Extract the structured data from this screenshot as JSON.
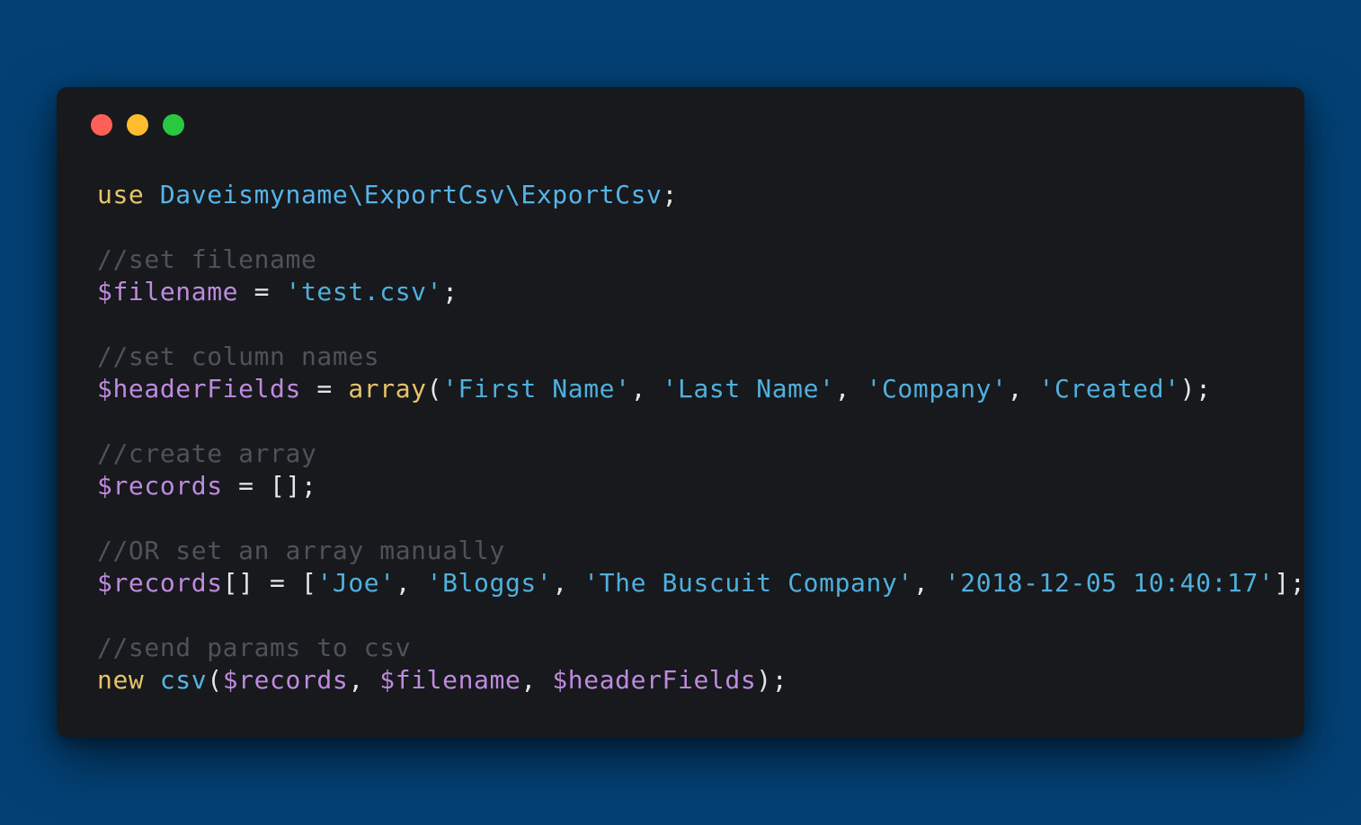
{
  "theme": {
    "background": "#034175",
    "window": "#17191c",
    "close_dot": "#fe5f57",
    "minimize_dot": "#febc2e",
    "zoom_dot": "#29c840",
    "keyword": "#e7c46a",
    "namespace": "#56b4e9",
    "variable": "#bf8adf",
    "string": "#4fb0de",
    "comment": "#4d5359",
    "plain": "#e6e6e6"
  },
  "window_controls": {
    "close_icon": "close-dot-icon",
    "minimize_icon": "minimize-dot-icon",
    "zoom_icon": "zoom-dot-icon"
  },
  "code": {
    "language": "php",
    "lines": [
      {
        "tokens": [
          {
            "t": "kw",
            "v": "use"
          },
          {
            "t": "punc",
            "v": " "
          },
          {
            "t": "ns",
            "v": "Daveismyname\\ExportCsv\\ExportCsv"
          },
          {
            "t": "punc",
            "v": ";"
          }
        ]
      },
      {
        "tokens": []
      },
      {
        "tokens": [
          {
            "t": "com",
            "v": "//set filename"
          }
        ]
      },
      {
        "tokens": [
          {
            "t": "var",
            "v": "$filename"
          },
          {
            "t": "op",
            "v": " = "
          },
          {
            "t": "str",
            "v": "'test.csv'"
          },
          {
            "t": "punc",
            "v": ";"
          }
        ]
      },
      {
        "tokens": []
      },
      {
        "tokens": [
          {
            "t": "com",
            "v": "//set column names"
          }
        ]
      },
      {
        "tokens": [
          {
            "t": "var",
            "v": "$headerFields"
          },
          {
            "t": "op",
            "v": " = "
          },
          {
            "t": "fn",
            "v": "array"
          },
          {
            "t": "punc",
            "v": "("
          },
          {
            "t": "str",
            "v": "'First Name'"
          },
          {
            "t": "punc",
            "v": ", "
          },
          {
            "t": "str",
            "v": "'Last Name'"
          },
          {
            "t": "punc",
            "v": ", "
          },
          {
            "t": "str",
            "v": "'Company'"
          },
          {
            "t": "punc",
            "v": ", "
          },
          {
            "t": "str",
            "v": "'Created'"
          },
          {
            "t": "punc",
            "v": ");"
          }
        ]
      },
      {
        "tokens": []
      },
      {
        "tokens": [
          {
            "t": "com",
            "v": "//create array"
          }
        ]
      },
      {
        "tokens": [
          {
            "t": "var",
            "v": "$records"
          },
          {
            "t": "op",
            "v": " = "
          },
          {
            "t": "punc",
            "v": "[];"
          }
        ]
      },
      {
        "tokens": []
      },
      {
        "tokens": [
          {
            "t": "com",
            "v": "//OR set an array manually"
          }
        ]
      },
      {
        "tokens": [
          {
            "t": "var",
            "v": "$records"
          },
          {
            "t": "punc",
            "v": "[]"
          },
          {
            "t": "op",
            "v": " = "
          },
          {
            "t": "punc",
            "v": "["
          },
          {
            "t": "str",
            "v": "'Joe'"
          },
          {
            "t": "punc",
            "v": ", "
          },
          {
            "t": "str",
            "v": "'Bloggs'"
          },
          {
            "t": "punc",
            "v": ", "
          },
          {
            "t": "str",
            "v": "'The Buscuit Company'"
          },
          {
            "t": "punc",
            "v": ", "
          },
          {
            "t": "str",
            "v": "'2018-12-05 10:40:17'"
          },
          {
            "t": "punc",
            "v": "];"
          }
        ]
      },
      {
        "tokens": []
      },
      {
        "tokens": [
          {
            "t": "com",
            "v": "//send params to csv"
          }
        ]
      },
      {
        "tokens": [
          {
            "t": "kw",
            "v": "new"
          },
          {
            "t": "punc",
            "v": " "
          },
          {
            "t": "call",
            "v": "csv"
          },
          {
            "t": "punc",
            "v": "("
          },
          {
            "t": "var",
            "v": "$records"
          },
          {
            "t": "punc",
            "v": ", "
          },
          {
            "t": "var",
            "v": "$filename"
          },
          {
            "t": "punc",
            "v": ", "
          },
          {
            "t": "var",
            "v": "$headerFields"
          },
          {
            "t": "punc",
            "v": ");"
          }
        ]
      }
    ]
  }
}
